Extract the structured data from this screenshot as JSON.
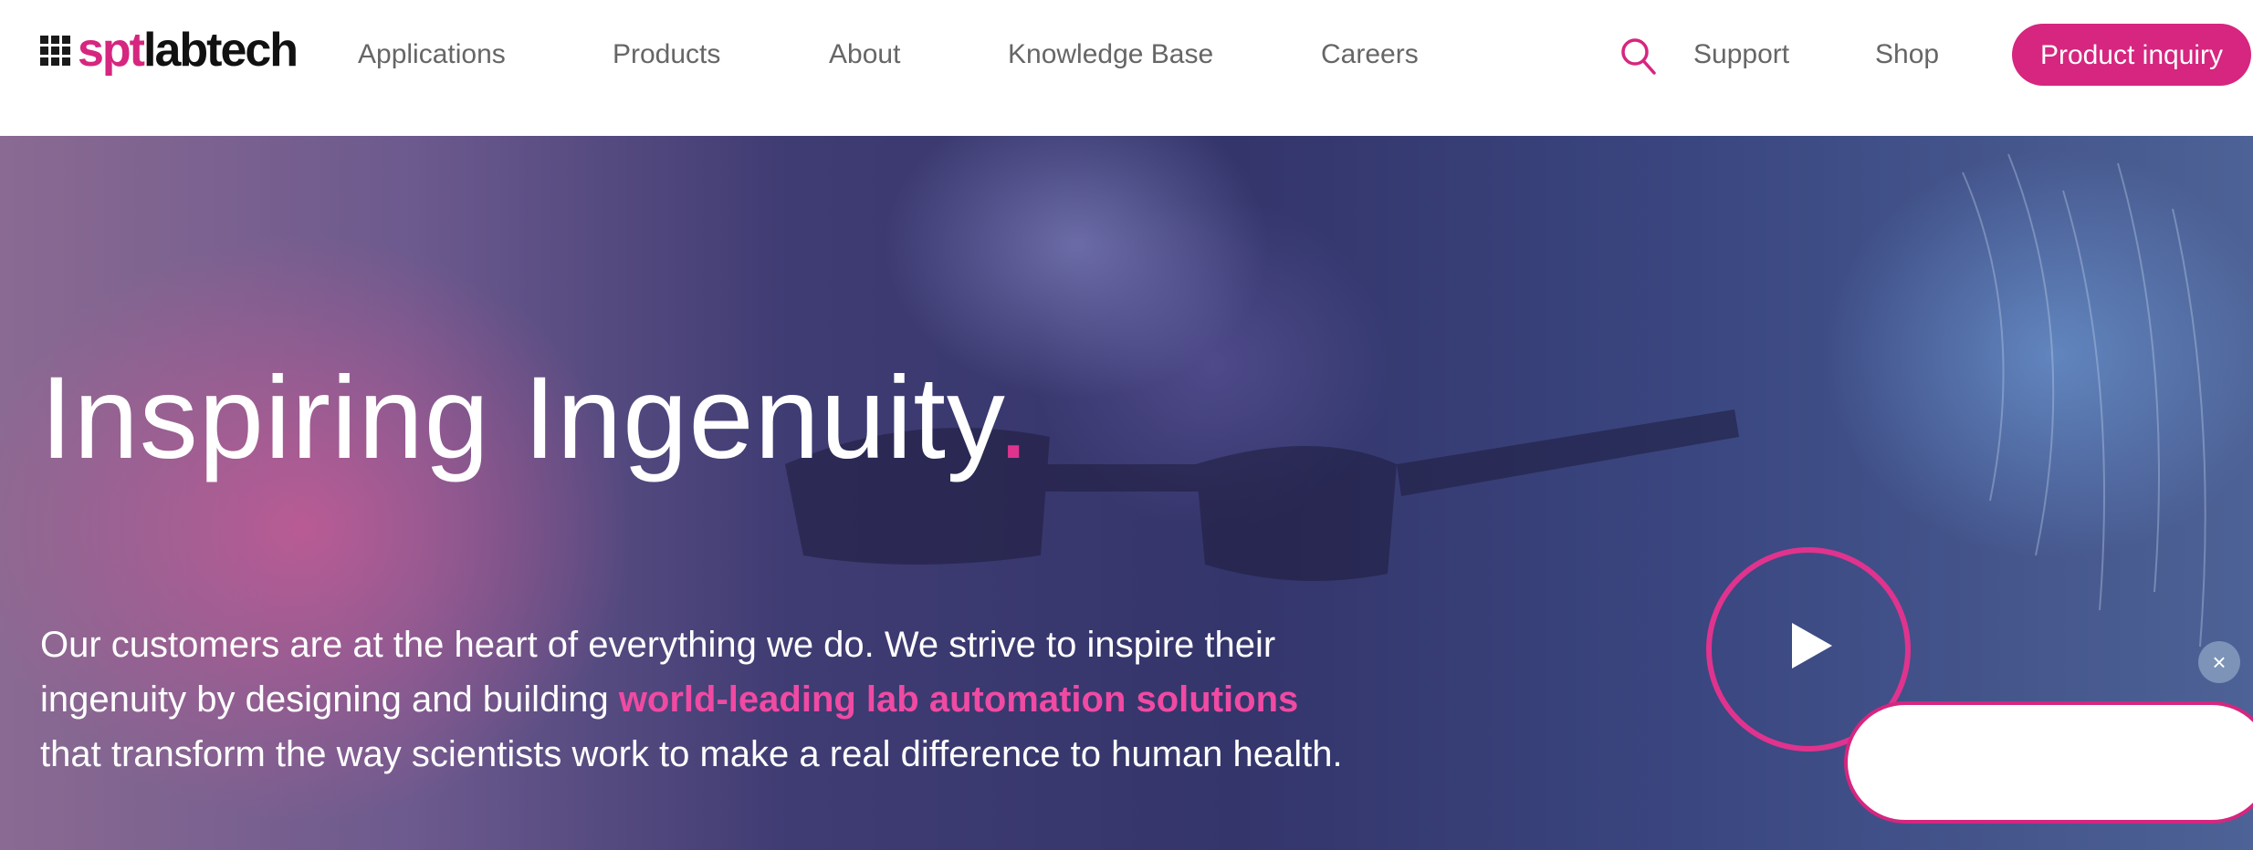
{
  "brand": {
    "logo_part1": "spt",
    "logo_part2": "labtech",
    "primary_color": "#d6267f"
  },
  "nav": {
    "items": [
      {
        "label": "Applications"
      },
      {
        "label": "Products"
      },
      {
        "label": "About"
      },
      {
        "label": "Knowledge Base"
      },
      {
        "label": "Careers"
      }
    ],
    "search_icon": "search-icon",
    "support_label": "Support",
    "shop_label": "Shop",
    "cta_label": "Product inquiry"
  },
  "hero": {
    "title": "Inspiring Ingenuity",
    "title_dot": ".",
    "text_part1": "Our customers are at the heart of everything we do. We strive to inspire their ingenuity by designing and building ",
    "text_highlight": "world-leading lab automation solutions",
    "text_part2": " that transform the way scientists work to make a real difference to human health.",
    "play_icon": "play-icon"
  },
  "chat": {
    "close_symbol": "×",
    "close_icon": "close-icon"
  }
}
